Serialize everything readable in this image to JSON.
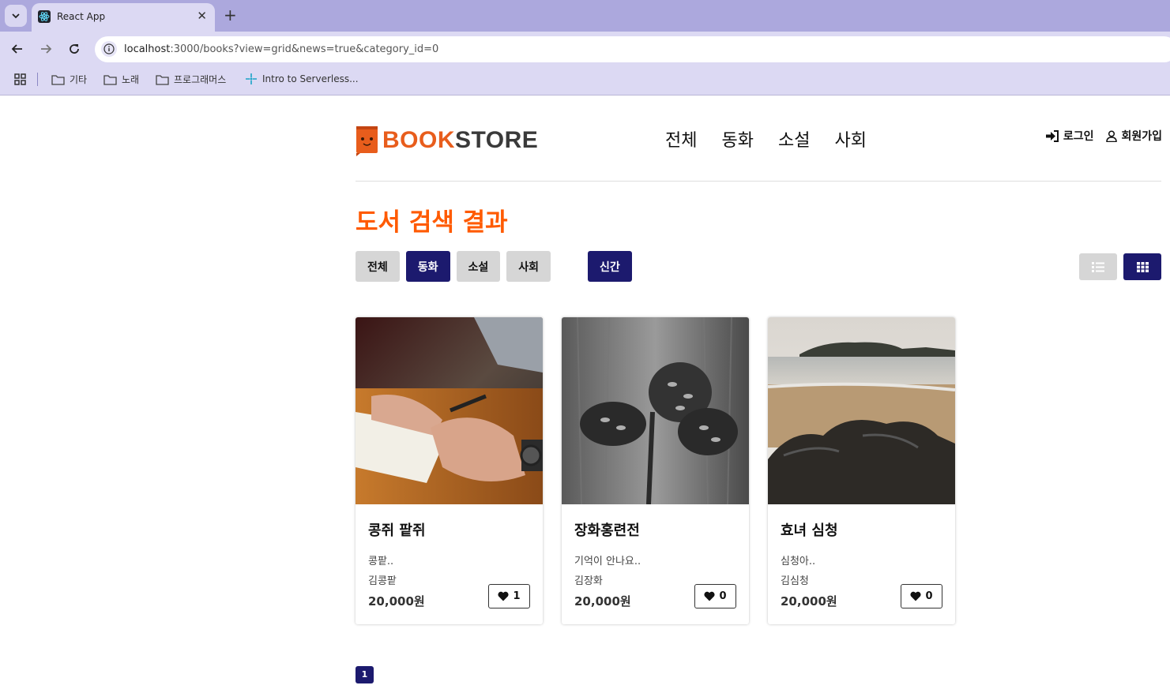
{
  "browser": {
    "tab_title": "React App",
    "url_host": "localhost",
    "url_rest": ":3000/books?view=grid&news=true&category_id=0",
    "bookmarks": [
      {
        "label": "기타",
        "icon": "folder-icon"
      },
      {
        "label": "노래",
        "icon": "folder-icon"
      },
      {
        "label": "프로그래머스",
        "icon": "folder-icon"
      },
      {
        "label": "Intro to Serverless...",
        "icon": "serverless-icon"
      }
    ]
  },
  "header": {
    "logo_part1": "BOOK",
    "logo_part2": "STORE",
    "nav": [
      "전체",
      "동화",
      "소설",
      "사회"
    ],
    "login": "로그인",
    "signup": "회원가입"
  },
  "main": {
    "title": "도서 검색 결과",
    "filters": [
      {
        "label": "전체",
        "active": false
      },
      {
        "label": "동화",
        "active": true
      },
      {
        "label": "소설",
        "active": false
      },
      {
        "label": "사회",
        "active": false
      }
    ],
    "news_filter": {
      "label": "신간",
      "active": true
    },
    "view_mode": "grid",
    "books": [
      {
        "title": "콩쥐 팥쥐",
        "summary": "콩팥..",
        "author": "김콩팥",
        "price": "20,000원",
        "likes": "1",
        "image": "writing-notebook"
      },
      {
        "title": "장화홍련전",
        "summary": "기억이 안나요..",
        "author": "김장화",
        "price": "20,000원",
        "likes": "0",
        "image": "pinecones"
      },
      {
        "title": "효녀 심청",
        "summary": "심청아..",
        "author": "김심청",
        "price": "20,000원",
        "likes": "0",
        "image": "beach-rocks"
      }
    ],
    "pagination": {
      "current": "1"
    }
  },
  "colors": {
    "accent": "#ff5a00",
    "primary": "#1c1a6e",
    "inactive": "#d6d6d6",
    "browser_frame": "#aca8dd"
  }
}
